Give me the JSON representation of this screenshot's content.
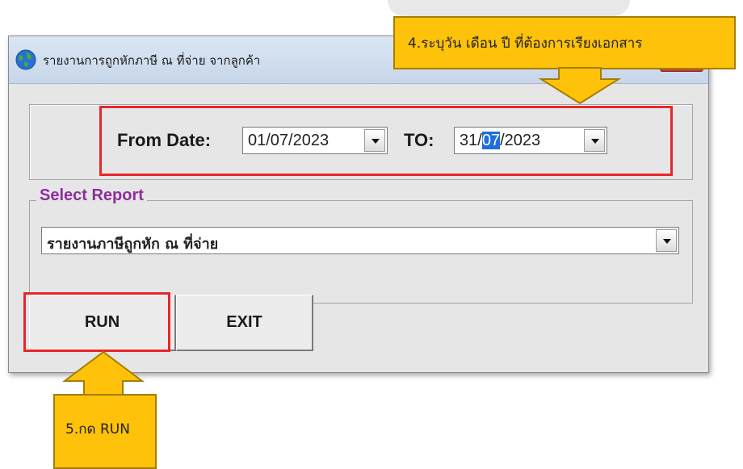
{
  "window": {
    "title": "รายงานการถูกหักภาษี ณ ที่จ่าย จากลูกค้า"
  },
  "date_range": {
    "from_label": "From Date:",
    "from_value": "01/07/2023",
    "to_label": "TO:",
    "to_value_prefix": "31/",
    "to_value_selected": "07",
    "to_value_suffix": "/2023"
  },
  "report": {
    "legend": "Select Report",
    "selected": "รายงานภาษีถูกหัก ณ ที่จ่าย"
  },
  "buttons": {
    "run": "RUN",
    "exit": "EXIT"
  },
  "callouts": {
    "step4": "4.ระบุวัน เดือน ปี ที่ต้องการเรียงเอกสาร",
    "step5": "5.กด RUN"
  },
  "colors": {
    "highlight": "#e8262a",
    "callout": "#fdc209",
    "legend": "#8e2d9e",
    "selection": "#1e6fd9"
  }
}
